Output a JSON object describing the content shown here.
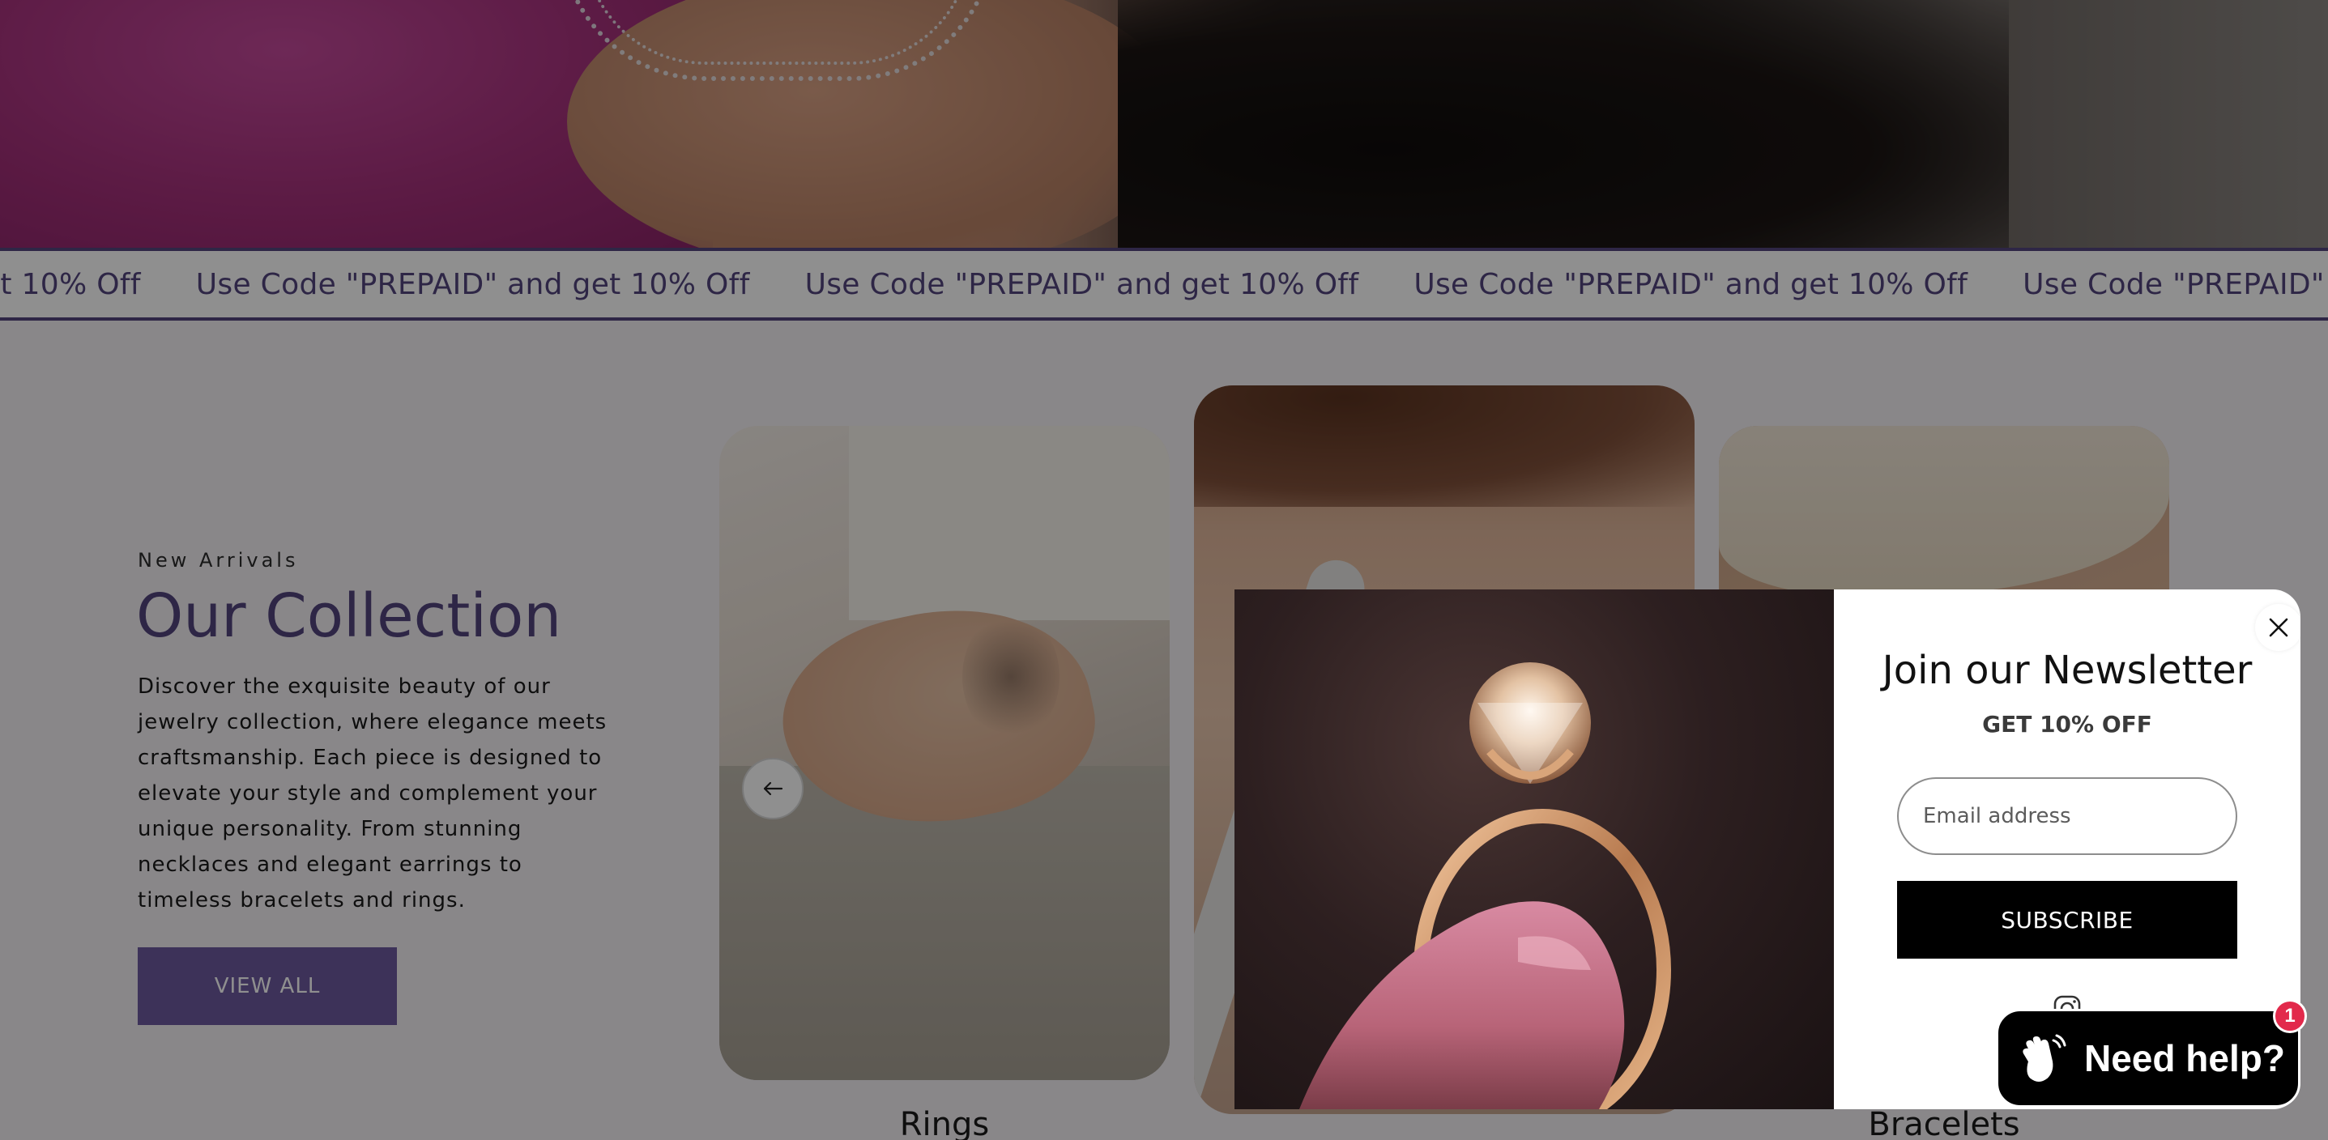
{
  "promo": {
    "text": "Use Code \"PREPAID\" and get 10% Off",
    "items": [
      "Use Code \"PREPAID\" and get 10% Off",
      "Use Code \"PREPAID\" and get 10% Off",
      "Use Code \"PREPAID\" and get 10% Off",
      "Use Code \"PREPAID\" and get 10% Off",
      "Use Code \"PREPAID\" and get 10% Off"
    ]
  },
  "collection": {
    "eyebrow": "New Arrivals",
    "heading": "Our Collection",
    "description": "Discover the exquisite beauty of our jewelry collection, where elegance meets craftsmanship. Each piece is designed to elevate your style and complement your unique personality. From stunning necklaces and elegant earrings to timeless bracelets and rings.",
    "cta_label": "VIEW ALL",
    "cards": [
      {
        "label": "Rings"
      },
      {
        "label": ""
      },
      {
        "label": "Bracelets"
      }
    ]
  },
  "newsletter": {
    "title": "Join our Newsletter",
    "subtitle": "GET 10% OFF",
    "email_placeholder": "Email address",
    "subscribe_label": "SUBSCRIBE"
  },
  "chat": {
    "label": "Need help?",
    "badge_count": "1"
  },
  "colors": {
    "brand_purple": "#52447e",
    "button_purple": "#6d5a9f",
    "overlay": "rgba(0,0,0,0.44)",
    "badge_red": "#e2294b"
  },
  "icons": [
    "arrow-left-icon",
    "close-icon",
    "instagram-icon",
    "waving-hand-icon"
  ]
}
